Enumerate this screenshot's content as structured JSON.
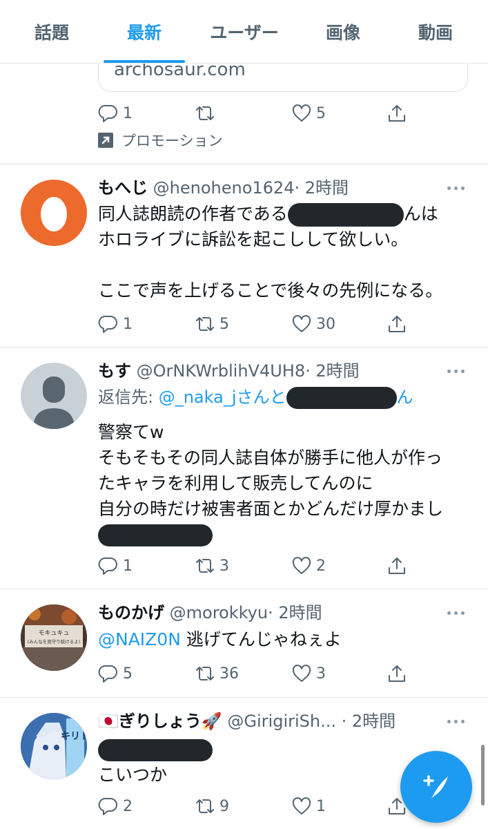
{
  "tabs": [
    "話題",
    "最新",
    "ユーザー",
    "画像",
    "動画"
  ],
  "active_tab": 1,
  "ad": {
    "domain": "archosaur.com",
    "replies": "1",
    "retweets": "",
    "likes": "5",
    "promo_label": "プロモーション"
  },
  "tweets": [
    {
      "name": "もへじ",
      "handle": "@henoheno1624",
      "time": "· 2時間",
      "line1_prefix": "同人誌朗読の作者である",
      "line1_suffix": "んは",
      "line2": "ホロライブに訴訟を起こしして欲しい。",
      "line3": "ここで声を上げることで後々の先例になる。",
      "replies": "1",
      "retweets": "5",
      "likes": "30"
    },
    {
      "name": "もす",
      "handle": "@OrNKWrblihV4UH8",
      "time": "· 2時間",
      "reply_prefix": "返信先: ",
      "reply_to": "@_naka_jさんと",
      "reply_suffix": "ん",
      "lines": [
        "警察てw",
        "そもそもその同人誌自体が勝手に他人が作っ",
        "たキャラを利用して販売してんのに",
        "自分の時だけ被害者面とかどんだけ厚かまし"
      ],
      "replies": "1",
      "retweets": "3",
      "likes": "2"
    },
    {
      "name": "ものかげ",
      "handle": "@morokkyu",
      "time": "· 2時間",
      "mention": "@NAIZ0N",
      "text": " 逃げてんじゃねぇよ",
      "avatar_text_1": "モキュキュ",
      "avatar_text_2": "(みんなを見守り続けるよ)",
      "replies": "5",
      "retweets": "36",
      "likes": "3"
    },
    {
      "name": "🇯🇵ぎりしょう🚀",
      "handle": "@GirigiriSh...",
      "time": "· 2時間",
      "text": "こいつか",
      "avatar_text": "キリト",
      "replies": "2",
      "retweets": "9",
      "likes": "1"
    }
  ]
}
